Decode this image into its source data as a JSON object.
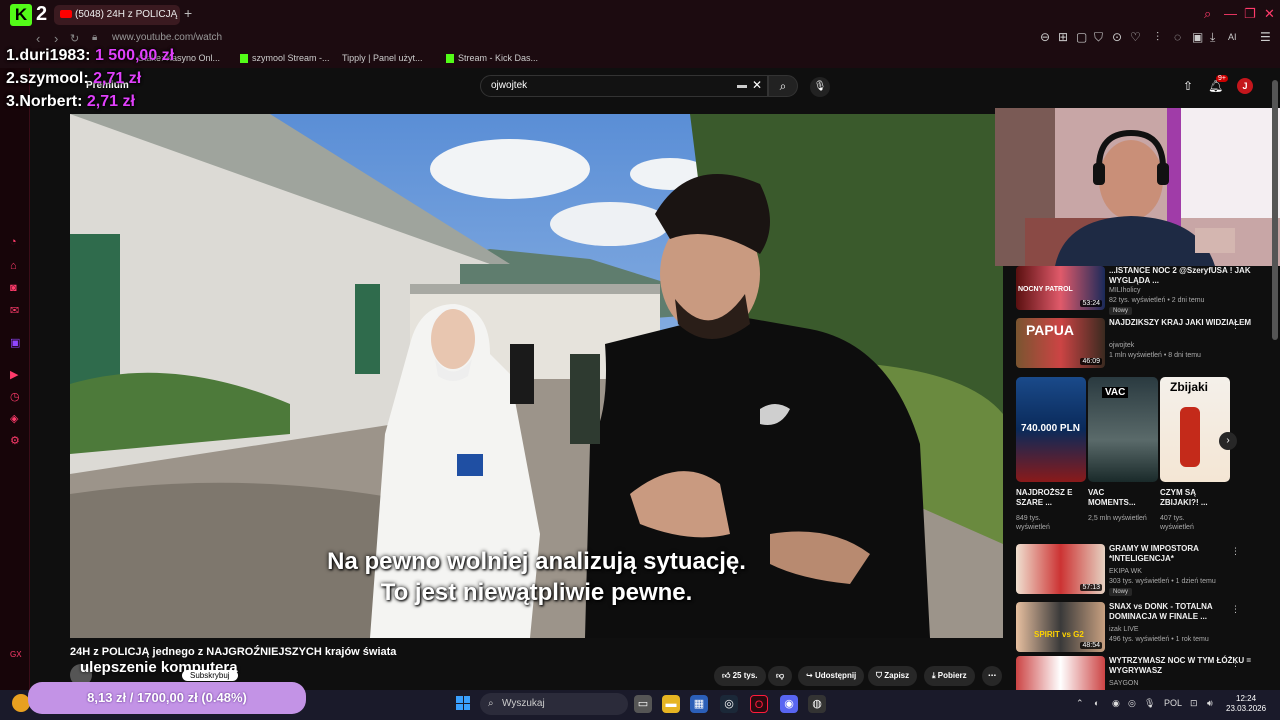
{
  "browser": {
    "brand_logo": "K",
    "brand_number": "2",
    "tab_title": "(5048) 24H z POLICJĄ",
    "new_tab": "+",
    "url": "www.youtube.com/watch",
    "bookmarks": [
      "Stake: Kasyno Onl...",
      "szymool Stream -...",
      "Tipply | Panel użyt...",
      "Stream - Kick Das..."
    ],
    "toolbar_ai": "AI"
  },
  "leaderboard": [
    {
      "rank": "1.duri1983:",
      "value": "1 500,00 zł"
    },
    {
      "rank": "2.szymool:",
      "value": "2,71 zł"
    },
    {
      "rank": "3.Norbert:",
      "value": "2,71 zł"
    }
  ],
  "youtube": {
    "premium_label": "Premium",
    "search_value": "ojwojtek",
    "notif_count": "9+",
    "avatar_letter": "J",
    "video_title": "24H z POLICJĄ jednego z NAJGROŹNIEJSZYCH krajów świata",
    "overlay_text": "ulepszenie komputera",
    "subscribe_label": "Subskrybuj",
    "likes": "25 tys.",
    "share": "Udostępnij",
    "save": "Zapisz",
    "download": "Pobierz",
    "subtitle_line1": "Na pewno wolniej analizują sytuację.",
    "subtitle_line2": "To jest niewątpliwie pewne."
  },
  "recommendations": [
    {
      "title": "...ISTANCE NOC 2 @SzeryfUSA ! JAK WYGLĄDA ...",
      "channel": "MILIholicy",
      "meta": "82 tys. wyświetleń • 2 dni temu",
      "duration": "53:24",
      "badge": "Nowy"
    },
    {
      "title": "NAJDZIKSZY KRAJ JAKI WIDZIAŁEM",
      "channel": "ojwojtek",
      "meta": "1 mln wyświetleń • 8 dni temu",
      "duration": "46:09",
      "badge": ""
    },
    {
      "title": "GRAMY W IMPOSTORA *INTELIGENCJA*",
      "channel": "EKIPA WK",
      "meta": "303 tys. wyświetleń • 1 dzień temu",
      "duration": "57:13",
      "badge": "Nowy"
    },
    {
      "title": "SNAX vs DONK - TOTALNA DOMINACJA W FINALE ...",
      "channel": "izak LIVE",
      "meta": "496 tys. wyświetleń • 1 rok temu",
      "duration": "48:54",
      "badge": ""
    },
    {
      "title": "WYTRZYMASZ NOC W TYM ŁÓŻKU = WYGRYWASZ",
      "channel": "SAYGON",
      "meta": "",
      "duration": "",
      "badge": ""
    }
  ],
  "thumb_text": {
    "papua": "PAPUA",
    "nocny": "NOCNY PATROL",
    "spirit": "SPIRIT vs G2"
  },
  "shorts": [
    {
      "title": "NAJDROŻSZ E SZARE ...",
      "views": "849 tys. wyświetleń",
      "overlay": "740.000 PLN"
    },
    {
      "title": "VAC MOMENTS...",
      "views": "2,5 mln wyświetleń",
      "overlay": "VAC"
    },
    {
      "title": "CZYM SĄ ZBIJAKI?! ...",
      "views": "407 tys. wyświetleń",
      "overlay": "Zbijaki"
    }
  ],
  "donation_goal": "8,13 zł / 1700,00 zł (0.48%)",
  "taskbar": {
    "search": "Wyszukaj",
    "lang": "POL",
    "time": "12:24",
    "date": "23.03.2026"
  },
  "colors": {
    "accent": "#e040fb",
    "kick": "#53fc18",
    "browser": "#1c0b10",
    "yt_red": "#ff0000"
  }
}
